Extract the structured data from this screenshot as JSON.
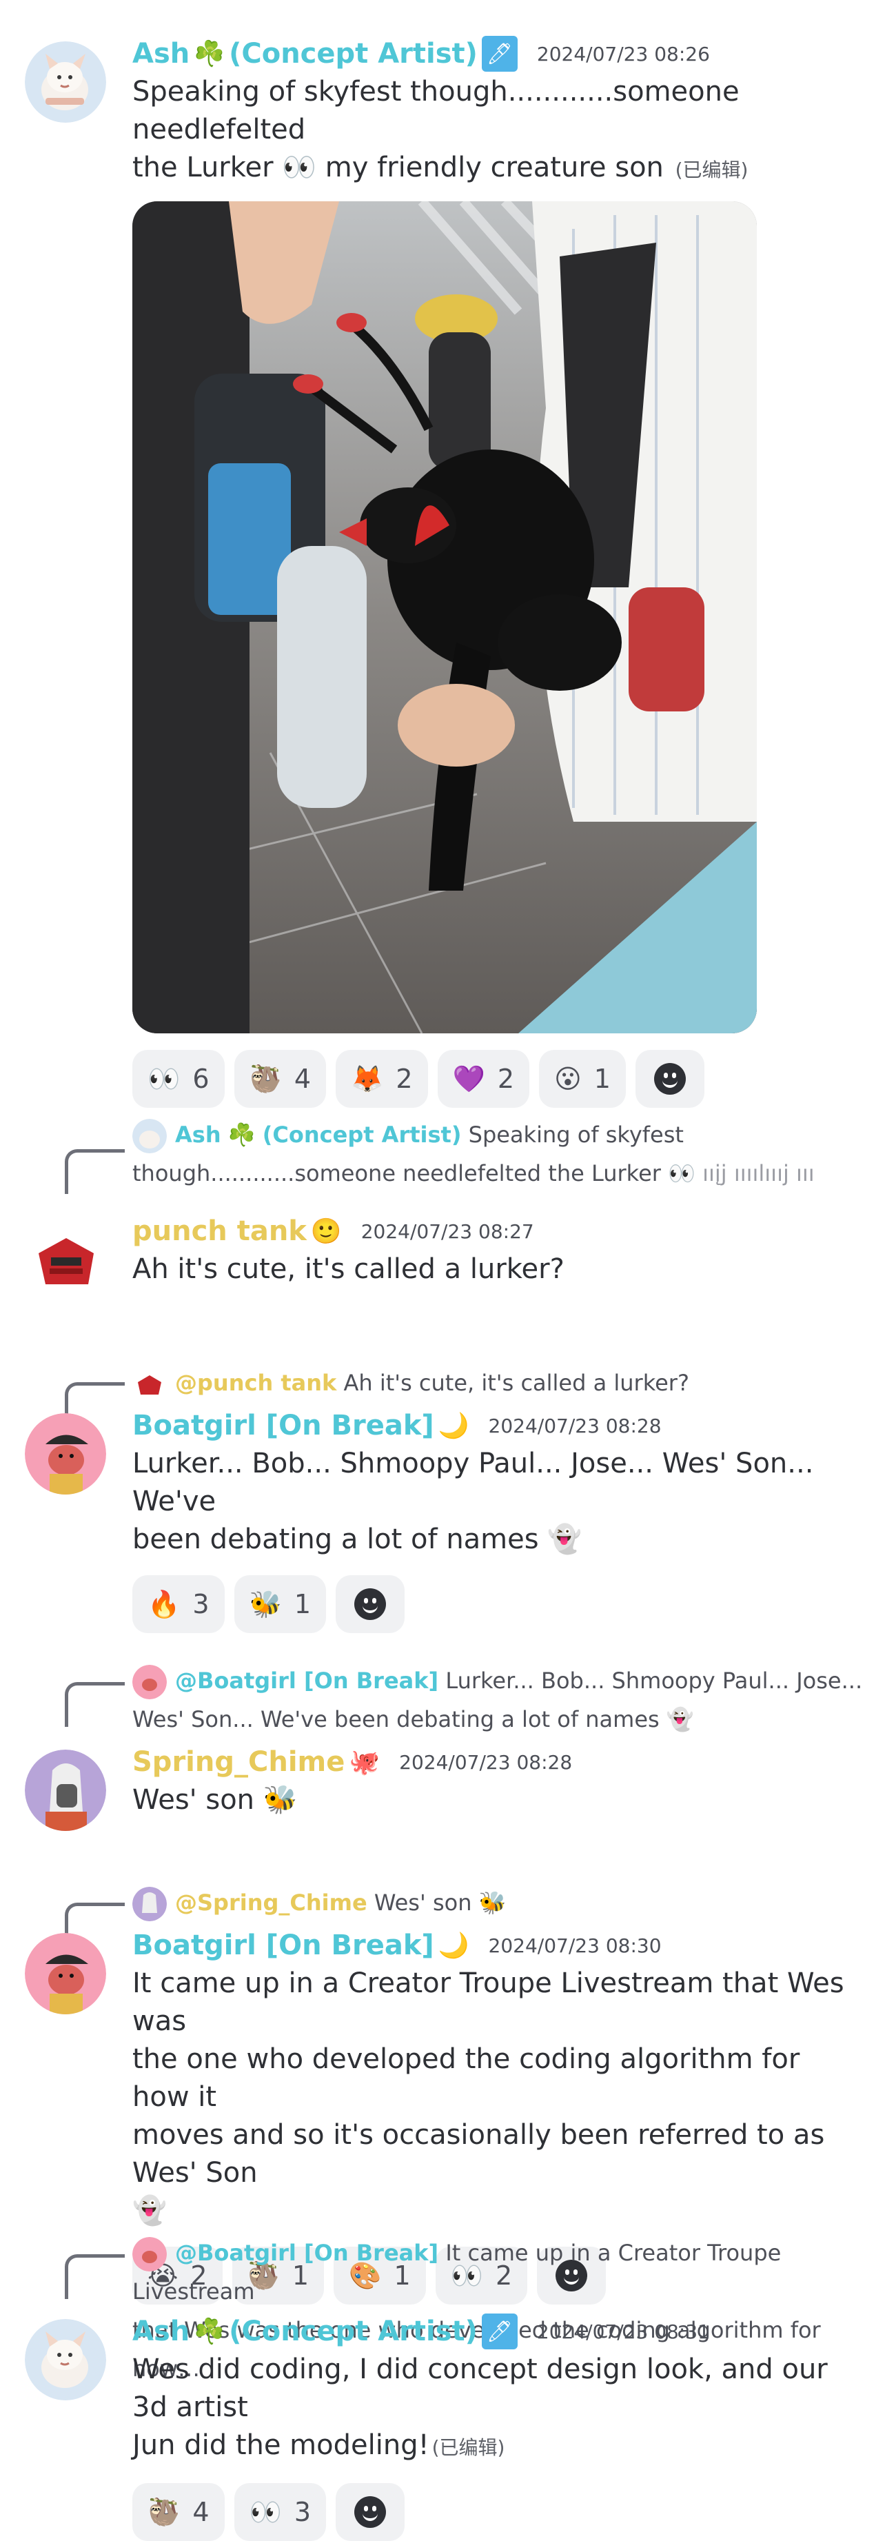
{
  "messages": [
    {
      "author": "Ash",
      "author_decor": "☘️",
      "role_tag": "(Concept Artist)",
      "role_icon": "🖊",
      "timestamp": "2024/07/23 08:26",
      "text_line1": "Speaking of skyfest though............someone needlefelted",
      "text_line2a": "the Lurker",
      "text_line2_emoji": "👀",
      "text_line2b": "my friendly creature son",
      "edited": "(已编辑)",
      "reactions": [
        {
          "emoji": "👀",
          "count": "6"
        },
        {
          "emoji": "🦥",
          "count": "4"
        },
        {
          "emoji": "🦊",
          "count": "2"
        },
        {
          "emoji": "💜",
          "count": "2"
        },
        {
          "emoji": "😮",
          "count": "1"
        }
      ]
    },
    {
      "reply_to_name": "Ash",
      "reply_to_decor": "☘️",
      "reply_to_role": "(Concept Artist)",
      "reply_to_text_a": "Speaking of skyfest",
      "reply_to_text_b": "though............someone needlefelted the Lurker",
      "reply_to_text_emoji": "👀",
      "reply_to_trailing": "ııįj ıııılıııj ııı",
      "author": "punch tank",
      "author_badge": "🙂",
      "timestamp": "2024/07/23 08:27",
      "text": "Ah it's cute,  it's called a lurker?"
    },
    {
      "reply_to_name": "@punch tank",
      "reply_to_text": "Ah it's cute,  it's called a lurker?",
      "author": "Boatgirl [On Break]",
      "author_badge": "🌙",
      "timestamp": "2024/07/23 08:28",
      "text_line1": "Lurker... Bob... Shmoopy Paul... Jose... Wes' Son... We've",
      "text_line2": "been debating a lot of names",
      "text_emoji": "👻",
      "reactions": [
        {
          "emoji": "🔥",
          "count": "3"
        },
        {
          "emoji": "🐝",
          "count": "1"
        }
      ]
    },
    {
      "reply_to_name": "@Boatgirl [On Break]",
      "reply_to_text_a": "Lurker... Bob... Shmoopy Paul... Jose...",
      "reply_to_text_b": "Wes' Son... We've been debating a lot of names",
      "reply_to_emoji": "👻",
      "author": "Spring_Chime",
      "author_badge": "🐙",
      "timestamp": "2024/07/23 08:28",
      "text": "Wes' son",
      "text_emoji": "🐝"
    },
    {
      "reply_to_name": "@Spring_Chime",
      "reply_to_text": "Wes' son",
      "reply_to_emoji": "🐝",
      "author": "Boatgirl [On Break]",
      "author_badge": "🌙",
      "timestamp": "2024/07/23 08:30",
      "text_line1": "It came up in a Creator Troupe Livestream that Wes was",
      "text_line2": "the one who developed the coding algorithm for how it",
      "text_line3": "moves and so it's occasionally been referred to as Wes' Son",
      "text_emoji": "👻",
      "reactions": [
        {
          "emoji": "😭",
          "count": "2"
        },
        {
          "emoji": "🦥",
          "count": "1"
        },
        {
          "emoji": "🎨",
          "count": "1"
        },
        {
          "emoji": "👀",
          "count": "2"
        }
      ]
    },
    {
      "reply_to_name": "@Boatgirl [On Break]",
      "reply_to_text_a": "It came up in a Creator Troupe Livestream",
      "reply_to_text_b": "that Wes was the one who developed the coding algorithm for how…",
      "author": "Ash",
      "author_decor": "☘️",
      "role_tag": "(Concept Artist)",
      "role_icon": "🖊",
      "timestamp": "2024/07/23 08:31",
      "text_line1": "Wes did coding, I did concept design look, and our 3d artist",
      "text_line2": "Jun did the modeling!",
      "edited": "(已编辑)",
      "reactions": [
        {
          "emoji": "🦥",
          "count": "4"
        },
        {
          "emoji": "👀",
          "count": "3"
        }
      ]
    }
  ],
  "colors": {
    "teal_name": "#4fc6d6",
    "yellow_name": "#e7c95a",
    "reaction_bg": "#f0f1f3",
    "reply_spine": "#6d6f78"
  }
}
